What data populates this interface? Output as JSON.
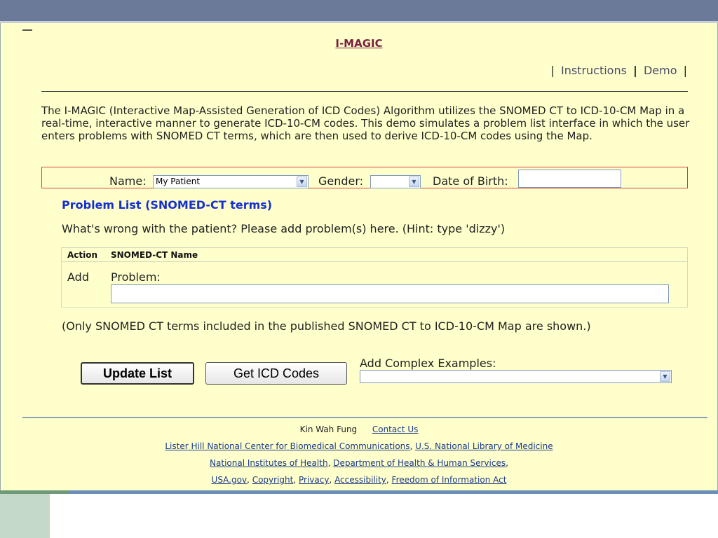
{
  "app": {
    "title": "I-MAGIC",
    "nav": {
      "instructions": "Instructions",
      "demo": "Demo"
    }
  },
  "intro": "The I-MAGIC (Interactive Map-Assisted Generation of ICD Codes) Algorithm utilizes the SNOMED CT to ICD-10-CM Map in a real-time, interactive manner to generate ICD-10-CM codes. This demo simulates a problem list interface in which the user enters problems with SNOMED CT terms, which are then used to derive ICD-10-CM codes using the Map.",
  "patient": {
    "name_label": "Name:",
    "name_value": "My Patient",
    "gender_label": "Gender:",
    "gender_value": "",
    "dob_label": "Date of Birth:",
    "dob_value": ""
  },
  "problem_list": {
    "title": "Problem List (SNOMED-CT terms)",
    "prompt": "What's wrong with the patient? Please add problem(s) here. (Hint: type 'dizzy')",
    "columns": [
      "Action",
      "SNOMED-CT Name"
    ],
    "row": {
      "action": "Add",
      "label": "Problem:",
      "value": ""
    },
    "note": "(Only SNOMED CT terms included in the published SNOMED CT to ICD-10-CM Map are shown.)"
  },
  "actions": {
    "update_list": "Update List",
    "get_icd_codes": "Get ICD Codes",
    "complex_label": "Add Complex Examples:",
    "complex_value": ""
  },
  "footer": {
    "author": "Kin Wah Fung",
    "contact": "Contact Us",
    "line2": [
      "Lister Hill National Center for Biomedical Communications",
      "U.S. National Library of Medicine"
    ],
    "line3": [
      "National Institutes of Health",
      "Department of Health & Human Services"
    ],
    "line4": [
      "USA.gov",
      "Copyright",
      "Privacy",
      "Accessibility",
      "Freedom of Information Act"
    ]
  },
  "colors": {
    "panel_bg": "#ffffcc",
    "title_link": "#7a1f3f",
    "section_title": "#1530d0",
    "patient_border": "#d84040"
  }
}
